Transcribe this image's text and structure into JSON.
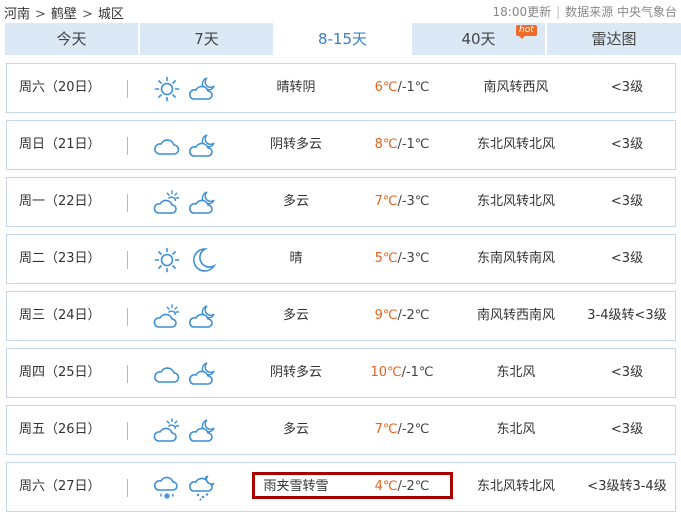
{
  "breadcrumb": {
    "province": "河南",
    "city": "鹤壁",
    "district": "城区",
    "separator": ">"
  },
  "meta": {
    "update_time": "18:00更新",
    "source": "数据来源 中央气象台"
  },
  "tabs": [
    {
      "label": "今天"
    },
    {
      "label": "7天"
    },
    {
      "label": "8-15天",
      "active": true
    },
    {
      "label": "40天",
      "badge": "hot"
    },
    {
      "label": "雷达图"
    }
  ],
  "colors": {
    "accent": "#3b7fc4",
    "tab_bg": "#dbe8f6",
    "high_temp": "#e8641b",
    "highlight": "#a80000",
    "badge": "#ef6a2b"
  },
  "forecast": [
    {
      "day": "周六（20日）",
      "icon_day": "sun-icon",
      "icon_night": "cloud-moon-icon",
      "weather": "晴转阴",
      "high": "6℃",
      "low": "/-1℃",
      "wind": "南风转西风",
      "level": "<3级"
    },
    {
      "day": "周日（21日）",
      "icon_day": "cloud-icon",
      "icon_night": "cloud-moon-icon",
      "weather": "阴转多云",
      "high": "8℃",
      "low": "/-1℃",
      "wind": "东北风转北风",
      "level": "<3级"
    },
    {
      "day": "周一（22日）",
      "icon_day": "sun-cloud-icon",
      "icon_night": "cloud-moon-icon",
      "weather": "多云",
      "high": "7℃",
      "low": "/-3℃",
      "wind": "东北风转北风",
      "level": "<3级"
    },
    {
      "day": "周二（23日）",
      "icon_day": "sun-icon",
      "icon_night": "moon-icon",
      "weather": "晴",
      "high": "5℃",
      "low": "/-3℃",
      "wind": "东南风转南风",
      "level": "<3级"
    },
    {
      "day": "周三（24日）",
      "icon_day": "sun-cloud-icon",
      "icon_night": "cloud-moon-icon",
      "weather": "多云",
      "high": "9℃",
      "low": "/-2℃",
      "wind": "南风转西南风",
      "level": "3-4级转<3级"
    },
    {
      "day": "周四（25日）",
      "icon_day": "cloud-icon",
      "icon_night": "cloud-moon-icon",
      "weather": "阴转多云",
      "high": "10℃",
      "low": "/-1℃",
      "wind": "东北风",
      "level": "<3级"
    },
    {
      "day": "周五（26日）",
      "icon_day": "sun-cloud-icon",
      "icon_night": "cloud-moon-icon",
      "weather": "多云",
      "high": "7℃",
      "low": "/-2℃",
      "wind": "东北风",
      "level": "<3级"
    },
    {
      "day": "周六（27日）",
      "icon_day": "sleet-icon",
      "icon_night": "snow-moon-icon",
      "weather": "雨夹雪转雪",
      "high": "4℃",
      "low": "/-2℃",
      "wind": "东北风转北风",
      "level": "<3级转3-4级"
    }
  ]
}
